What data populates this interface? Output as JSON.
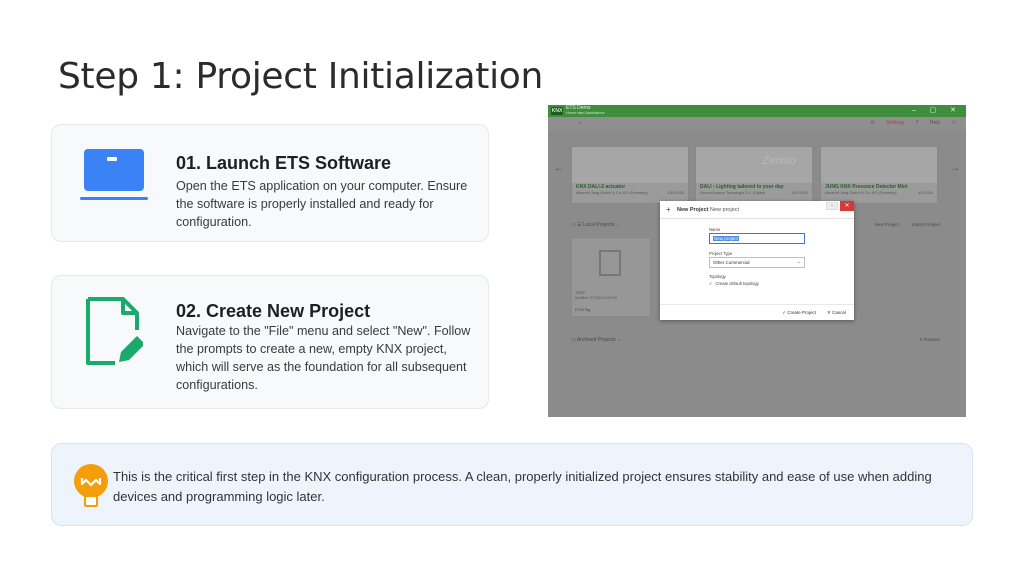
{
  "slide": {
    "title": "Step 1: Project Initialization"
  },
  "steps": [
    {
      "heading": "01. Launch ETS Software",
      "body": "Open the ETS application on your computer. Ensure the software is properly installed and ready for configuration.",
      "icon": "laptop-icon",
      "icon_color": "#3b82f6"
    },
    {
      "heading": "02. Create New Project",
      "body": "Navigate to the \"File\" menu and select \"New\". Follow the prompts to create a new, empty KNX project, which will serve as the foundation for all subsequent configurations.",
      "icon": "edit-document-icon",
      "icon_color": "#1aaa6b"
    }
  ],
  "screenshot": {
    "app_title": "ETS Demo",
    "app_subtitle": "Home and Assistance",
    "logo": "KNX",
    "toolbar_right": [
      "Settings",
      "Help"
    ],
    "featured": [
      {
        "title": "KNX DALI-2 actuator",
        "subtitle": "Albrecht Jung GmbH & Co. KG (Germany)",
        "date": "1/10/2024"
      },
      {
        "title": "DALI - Lighting tailored to your day",
        "subtitle": "Zennio Avance Tecnologia S.L. (Spain)",
        "date": "1/10/2024"
      },
      {
        "title": "JUNG KNX Presence Detector Mini",
        "subtitle": "Albrecht Jung GmbH & Co. KG (Germany)",
        "date": "4/1/2024"
      }
    ],
    "featured_brand": "Zennio",
    "local_projects_label": "Local Projects",
    "local_actions": [
      "New Project",
      "Import Project"
    ],
    "project_card": {
      "name": "TEST",
      "info": "Modified 7/7/2024 9:23 PM",
      "tag": "ETS6 Tag"
    },
    "archived_label": "Archived Projects",
    "restore_label": "Restore",
    "dialog": {
      "title": "New Project",
      "title2": "New project",
      "name_label": "Name",
      "name_value": "New project",
      "type_label": "Project Type",
      "type_value": "Other Commercial",
      "topology_label": "Topology",
      "checkbox_label": "Create default topology",
      "create_button": "Create Project",
      "cancel_button": "Cancel"
    }
  },
  "callout": {
    "text": "This is the critical first step in the KNX configuration process. A clean, properly initialized project ensures stability and ease of use when adding devices and programming logic later.",
    "icon": "lightbulb-icon",
    "icon_color": "#f59e0b"
  }
}
